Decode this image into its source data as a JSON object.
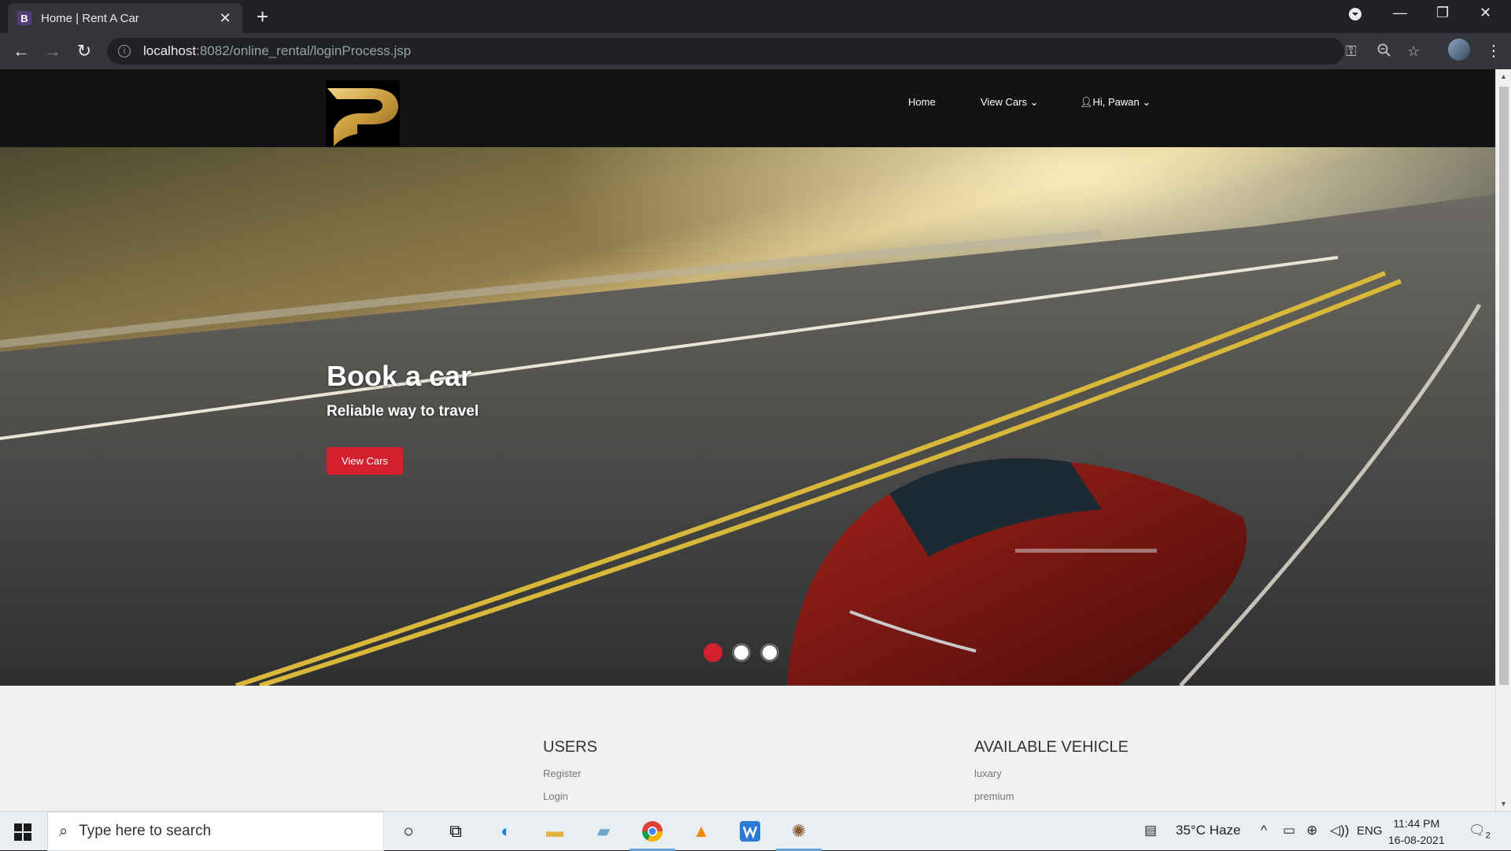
{
  "browser": {
    "tab_title": "Home | Rent A Car",
    "tab_favicon_letter": "B",
    "url_host": "localhost",
    "url_rest": ":8082/online_rental/loginProcess.jsp",
    "new_tab": "+",
    "close_glyph": "✕"
  },
  "site": {
    "nav": {
      "home": "Home",
      "view_cars": "View Cars",
      "user": "Hi, Pawan"
    },
    "hero": {
      "title": "Book a car",
      "subtitle": "Reliable way to travel",
      "button": "View Cars",
      "active_slide": 1,
      "slide_count": 3,
      "accent_color": "#d3202e"
    },
    "footer": {
      "users_heading": "USERS",
      "users_links": [
        "Register",
        "Login"
      ],
      "vehicle_heading": "AVAILABLE VEHICLE",
      "vehicle_links": [
        "luxary",
        "premium"
      ]
    }
  },
  "taskbar": {
    "search_placeholder": "Type here to search",
    "weather": "35°C  Haze",
    "language": "ENG",
    "time": "11:44 PM",
    "date": "16-08-2021",
    "notifications": "2"
  }
}
